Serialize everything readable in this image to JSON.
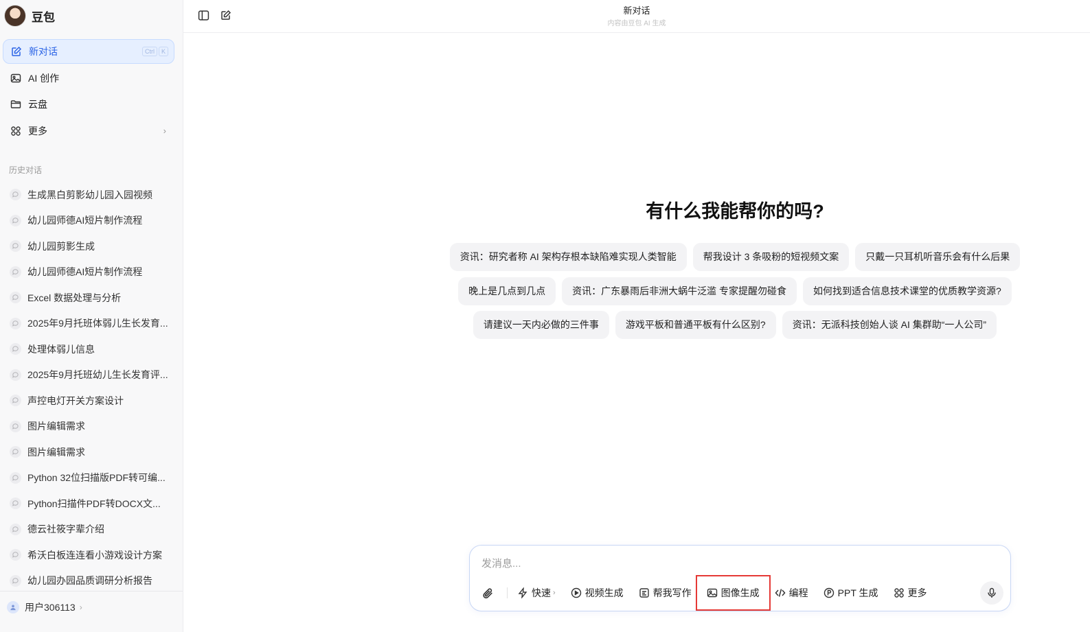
{
  "app": {
    "name": "豆包"
  },
  "sidebar": {
    "nav": [
      {
        "label": "新对话",
        "icon": "new-chat-icon",
        "shortcut": [
          "Ctrl",
          "K"
        ]
      },
      {
        "label": "AI 创作",
        "icon": "image-icon"
      },
      {
        "label": "云盘",
        "icon": "folder-icon"
      },
      {
        "label": "更多",
        "icon": "grid-icon"
      }
    ],
    "history_title": "历史对话",
    "history": [
      "生成黑白剪影幼儿园入园视频",
      "幼儿园师德AI短片制作流程",
      "幼儿园剪影生成",
      "幼儿园师德AI短片制作流程",
      "Excel 数据处理与分析",
      "2025年9月托班体弱儿生长发育...",
      "处理体弱儿信息",
      "2025年9月托班幼儿生长发育评...",
      "声控电灯开关方案设计",
      "图片编辑需求",
      "图片编辑需求",
      "Python 32位扫描版PDF转可编...",
      "Python扫描件PDF转DOCX文...",
      "德云社筱字辈介绍",
      "希沃白板连连看小游戏设计方案",
      "幼儿园办园品质调研分析报告"
    ],
    "user": "用户306113"
  },
  "topbar": {
    "title": "新对话",
    "subtitle": "内容由豆包 AI 生成"
  },
  "main": {
    "headline": "有什么我能帮你的吗?",
    "suggestions": [
      [
        "资讯：研究者称 AI 架构存根本缺陷难实现人类智能",
        "帮我设计 3 条吸粉的短视频文案",
        "只戴一只耳机听音乐会有什么后果"
      ],
      [
        "晚上是几点到几点",
        "资讯：广东暴雨后非洲大蜗牛泛滥 专家提醒勿碰食",
        "如何找到适合信息技术课堂的优质教学资源?"
      ],
      [
        "请建议一天内必做的三件事",
        "游戏平板和普通平板有什么区别?",
        "资讯：无派科技创始人谈 AI 集群助“一人公司”"
      ]
    ]
  },
  "composer": {
    "placeholder": "发消息...",
    "value": "",
    "tools": {
      "fast": "快速",
      "video": "视频生成",
      "write": "帮我写作",
      "image": "图像生成",
      "code": "编程",
      "ppt": "PPT 生成",
      "more": "更多"
    },
    "highlight_color": "#e53935"
  },
  "colors": {
    "accent": "#2a63e6",
    "active_bg": "#e6efff"
  }
}
